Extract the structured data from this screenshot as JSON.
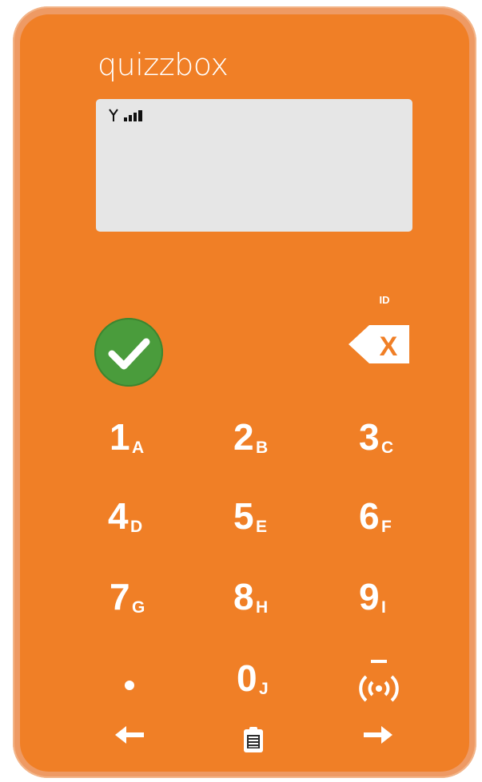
{
  "device": {
    "brand": "quizzbox",
    "body_color": "#f07f26",
    "frame_color": "#ee9a64",
    "screen_color": "#e6e6e6"
  },
  "screen": {
    "icons": [
      "antenna-icon",
      "signal-bars-icon"
    ]
  },
  "controls": {
    "id_label": "ID",
    "ok_icon": "check-icon",
    "ok_color": "#4a9c3c",
    "backspace_icon": "backspace-x-icon",
    "backspace_glyph": "X"
  },
  "keypad": {
    "keys": [
      {
        "digit": "1",
        "letter": "A"
      },
      {
        "digit": "2",
        "letter": "B"
      },
      {
        "digit": "3",
        "letter": "C"
      },
      {
        "digit": "4",
        "letter": "D"
      },
      {
        "digit": "5",
        "letter": "E"
      },
      {
        "digit": "6",
        "letter": "F"
      },
      {
        "digit": "7",
        "letter": "G"
      },
      {
        "digit": "8",
        "letter": "H"
      },
      {
        "digit": "9",
        "letter": "I"
      },
      {
        "digit": "0",
        "letter": "J"
      }
    ],
    "extra_keys": [
      "dot-icon",
      "radio-signal-icon"
    ]
  },
  "navigation": {
    "icons": [
      "arrow-left-icon",
      "clipboard-icon",
      "arrow-right-icon"
    ]
  }
}
